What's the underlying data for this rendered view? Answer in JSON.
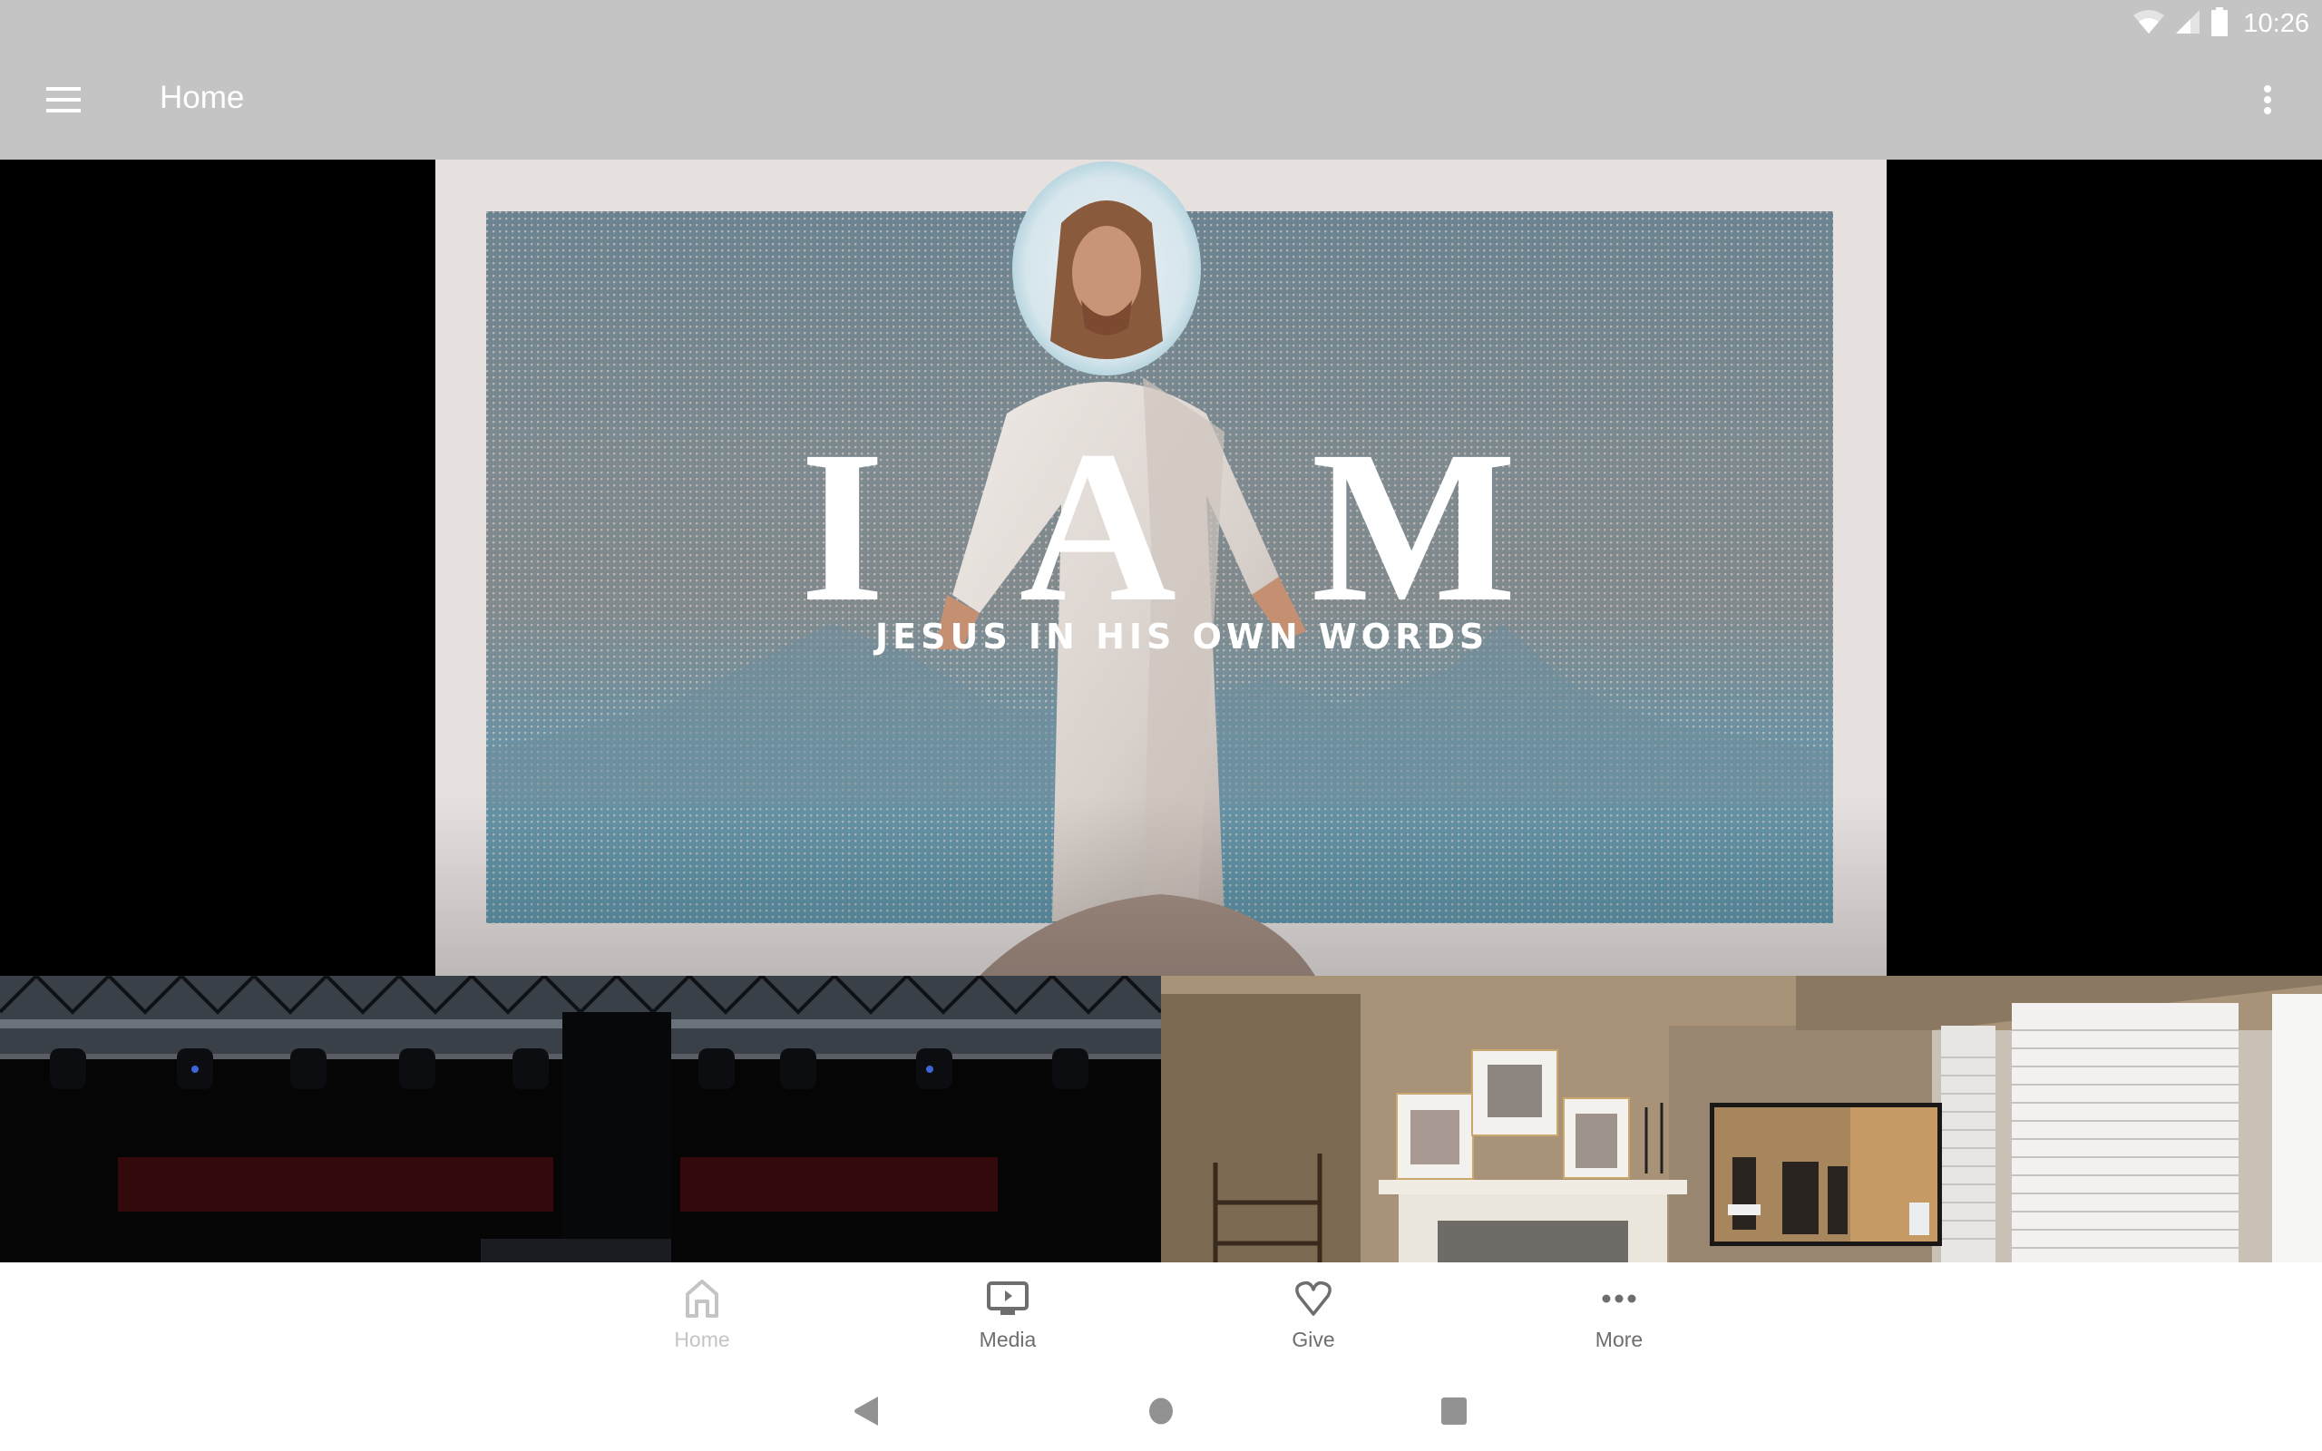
{
  "status_bar": {
    "time": "10:26",
    "icons": [
      "wifi-icon",
      "cell-signal-icon",
      "battery-icon"
    ]
  },
  "app_bar": {
    "title": "Home",
    "left_icon": "menu-icon",
    "right_icon": "more-vert-icon"
  },
  "hero": {
    "headline_letters": [
      "I",
      "A",
      "M"
    ],
    "subtitle": "JESUS IN HIS OWN WORDS",
    "colors": {
      "card": "#e6e1df",
      "letterbox": "#000000",
      "sky": "#6b8391",
      "sea": "#5e95aa"
    }
  },
  "tiles": [
    {
      "name": "stage-video",
      "description": "Dark stage with lighting truss and red curtain"
    },
    {
      "name": "living-room-video",
      "description": "Living room with fireplace, photos and TV showing worship band"
    }
  ],
  "bottom_nav": {
    "items": [
      {
        "label": "Home",
        "icon": "home-icon",
        "selected": true
      },
      {
        "label": "Media",
        "icon": "tv-play-icon",
        "selected": false
      },
      {
        "label": "Give",
        "icon": "heart-icon",
        "selected": false
      },
      {
        "label": "More",
        "icon": "more-horiz-icon",
        "selected": false
      }
    ],
    "colors": {
      "selected": "#c4c4c4",
      "unselected": "#6e6e6e"
    }
  },
  "system_nav": {
    "buttons": [
      "back-icon",
      "home-circle-icon",
      "recents-icon"
    ]
  }
}
